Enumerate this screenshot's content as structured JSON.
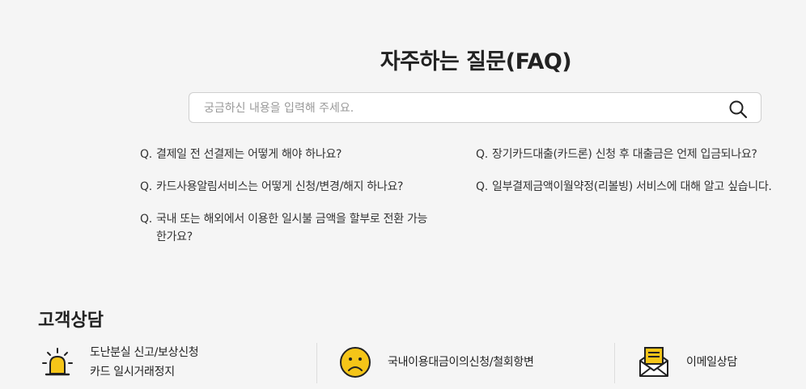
{
  "page": {
    "title": "자주하는 질문(FAQ)"
  },
  "search": {
    "placeholder": "궁금하신 내용을 입력해 주세요."
  },
  "faq": {
    "prefix": "Q.",
    "left": [
      "결제일 전 선결제는 어떻게 해야 하나요?",
      "카드사용알림서비스는 어떻게 신청/변경/해지 하나요?",
      "국내 또는 해외에서 이용한 일시불 금액을 할부로 전환 가능한가요?"
    ],
    "right": [
      "장기카드대출(카드론) 신청 후 대출금은 언제 입금되나요?",
      "일부결제금액이월약정(리볼빙) 서비스에 대해 알고 싶습니다."
    ]
  },
  "consult": {
    "title": "고객상담",
    "items": [
      {
        "line1": "도난분실 신고/보상신청",
        "line2": "카드 일시거래정지",
        "icon": "siren-icon"
      },
      {
        "line1": "국내이용대금이의신청/철회항변",
        "icon": "sad-face-icon"
      },
      {
        "line1": "이메일상담",
        "icon": "email-icon"
      }
    ]
  },
  "colors": {
    "accent": "#f5c518",
    "background": "#f5f5f5"
  }
}
